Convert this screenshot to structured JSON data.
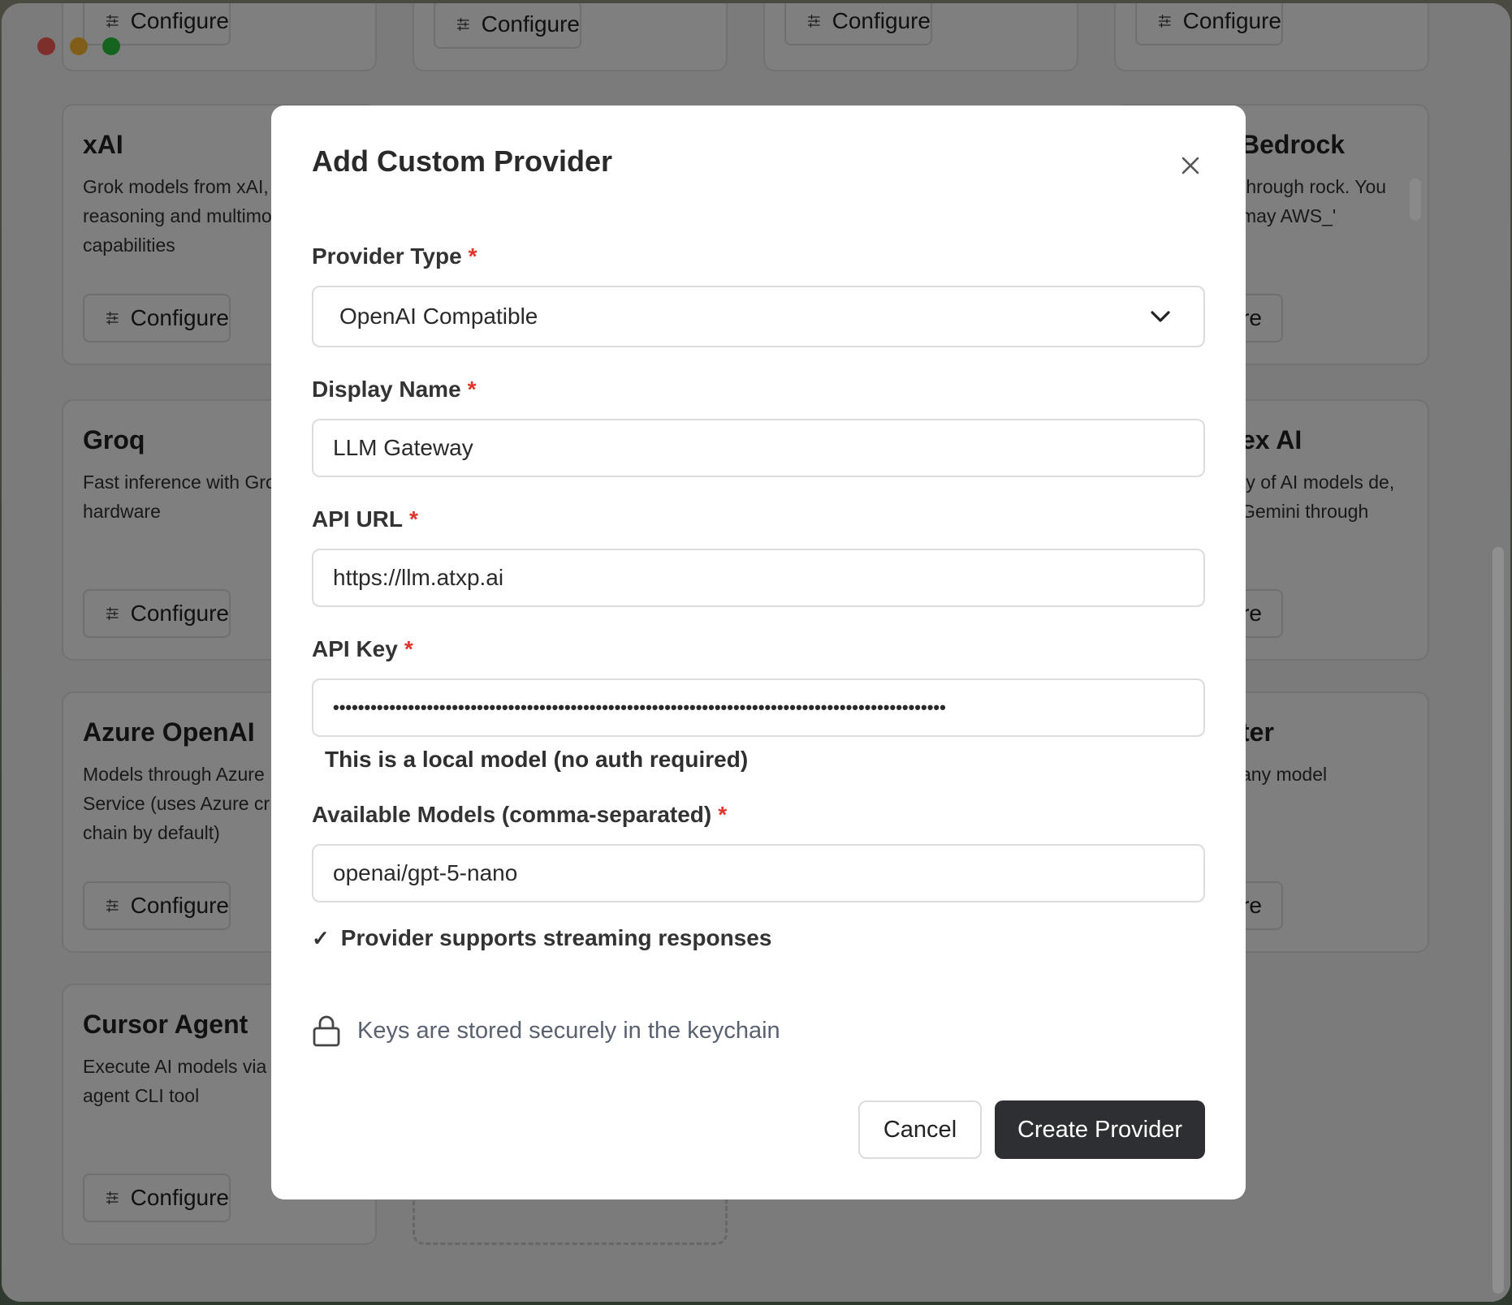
{
  "background_page": {
    "cards": [
      {
        "title": "",
        "description": "",
        "button": "Configure"
      },
      {
        "title": "",
        "description": "",
        "button": "Configure"
      },
      {
        "title": "",
        "description": "",
        "button": "Configure"
      },
      {
        "title": "",
        "description": "",
        "button": "Configure"
      },
      {
        "title": "xAI",
        "description": "Grok models from xAI, including reasoning and multimodal capabilities",
        "button": "Configure"
      },
      {
        "title": "Bedrock",
        "description": "through rock. You may AWS_'",
        "button": "gure"
      },
      {
        "title": "Groq",
        "description": "Fast inference with Groq hardware",
        "button": "Configure"
      },
      {
        "title": "ex AI",
        "description": "ty of AI models de, Gemini through",
        "button": "gure"
      },
      {
        "title": "Azure OpenAI",
        "description": "Models through Azure Service (uses Azure cr chain by default)",
        "button": "Configure"
      },
      {
        "title": "ter",
        "description": "any model",
        "button": "gure"
      },
      {
        "title": "Cursor Agent",
        "description": "Execute AI models via agent CLI tool",
        "button": "Configure"
      }
    ]
  },
  "modal": {
    "title": "Add Custom Provider",
    "required_marker": "*",
    "provider_type": {
      "label": "Provider Type",
      "value": "OpenAI Compatible"
    },
    "display_name": {
      "label": "Display Name",
      "value": "LLM Gateway"
    },
    "api_url": {
      "label": "API URL",
      "value": "https://llm.atxp.ai"
    },
    "api_key": {
      "label": "API Key",
      "value": "••••••••••••••••••••••••••••••••••••••••••••••••••••••••••••••••••••••••••••••••••••••••••••••••••"
    },
    "local_model_note": "This is a local model (no auth required)",
    "available_models": {
      "label": "Available Models (comma-separated)",
      "value": "openai/gpt-5-nano"
    },
    "streaming": {
      "check": "✓",
      "label": "Provider supports streaming responses"
    },
    "keychain_note": "Keys are stored securely in the keychain",
    "cancel": "Cancel",
    "create": "Create Provider"
  },
  "icons": {
    "close": "close-icon",
    "chevron": "chevron-down-icon",
    "lock": "lock-icon",
    "configure": "sliders-icon"
  },
  "colors": {
    "required": "#e0342c",
    "primary_button": "#2d2f33",
    "overlay": "rgba(0,0,0,0.5)"
  }
}
